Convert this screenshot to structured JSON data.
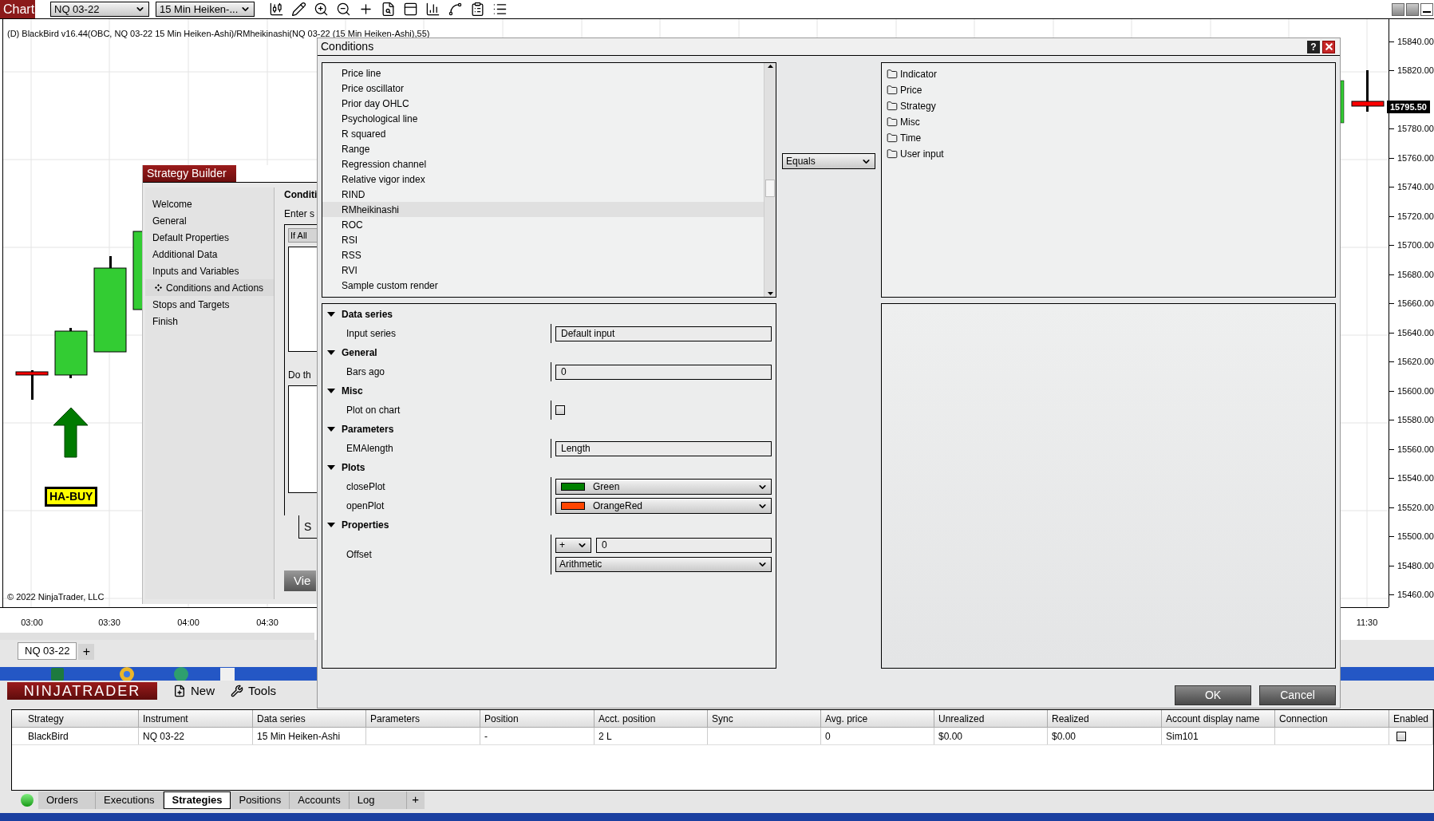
{
  "toolbar": {
    "title": "Chart",
    "instrument": "NQ 03-22",
    "bar_type": "15 Min Heiken-..."
  },
  "chart": {
    "title": "(D) BlackBird v16.44(OBC, NQ 03-22 15 Min Heiken-Ashi)/RMheikinashi(NQ 03-22 (15 Min Heiken-Ashi),55)",
    "signal": "HA-BUY",
    "copyright": "© 2022 NinjaTrader, LLC",
    "price_labels": [
      "15840.00",
      "15820.00",
      "15780.00",
      "15760.00",
      "15740.00",
      "15720.00",
      "15700.00",
      "15680.00",
      "15660.00",
      "15640.00",
      "15620.00",
      "15600.00",
      "15580.00",
      "15560.00",
      "15540.00",
      "15520.00",
      "15500.00",
      "15480.00",
      "15460.00"
    ],
    "last_price": "15795.50",
    "time_labels": [
      "03:00",
      "03:30",
      "04:00",
      "04:30",
      "11:30"
    ]
  },
  "chart_tabs": {
    "tabs": [
      {
        "label": "NQ 03-22",
        "selected": true
      }
    ],
    "add": "+"
  },
  "strategy_builder": {
    "title": "Strategy Builder",
    "nav": [
      {
        "label": "Welcome",
        "selected": false
      },
      {
        "label": "General",
        "selected": false
      },
      {
        "label": "Default Properties",
        "selected": false
      },
      {
        "label": "Additional Data",
        "selected": false
      },
      {
        "label": "Inputs and Variables",
        "selected": false
      },
      {
        "label": "Conditions and Actions",
        "selected": true
      },
      {
        "label": "Stops and Targets",
        "selected": false
      },
      {
        "label": "Finish",
        "selected": false
      }
    ],
    "heading": "Conditi",
    "hint": "Enter s",
    "if_all": "If All",
    "do_label": "Do th",
    "tab": "S",
    "view_button": "Vie"
  },
  "conditions": {
    "title": "Conditions",
    "help": "?",
    "items": [
      {
        "label": "Price line",
        "selected": false
      },
      {
        "label": "Price oscillator",
        "selected": false
      },
      {
        "label": "Prior day OHLC",
        "selected": false
      },
      {
        "label": "Psychological line",
        "selected": false
      },
      {
        "label": "R squared",
        "selected": false
      },
      {
        "label": "Range",
        "selected": false
      },
      {
        "label": "Regression channel",
        "selected": false
      },
      {
        "label": "Relative vigor index",
        "selected": false
      },
      {
        "label": "RIND",
        "selected": false
      },
      {
        "label": "RMheikinashi",
        "selected": true
      },
      {
        "label": "ROC",
        "selected": false
      },
      {
        "label": "RSI",
        "selected": false
      },
      {
        "label": "RSS",
        "selected": false
      },
      {
        "label": "RVI",
        "selected": false
      },
      {
        "label": "Sample custom render",
        "selected": false
      }
    ],
    "operator": "Equals",
    "tree": [
      {
        "label": "Indicator"
      },
      {
        "label": "Price"
      },
      {
        "label": "Strategy"
      },
      {
        "label": "Misc"
      },
      {
        "label": "Time"
      },
      {
        "label": "User input"
      }
    ],
    "properties": [
      {
        "label": "Data series",
        "expanded": true,
        "rows": [
          {
            "label": "Input series",
            "kind": "text",
            "value": "Default input"
          }
        ]
      },
      {
        "label": "General",
        "expanded": true,
        "rows": [
          {
            "label": "Bars ago",
            "kind": "text",
            "value": "0"
          }
        ]
      },
      {
        "label": "Misc",
        "expanded": true,
        "rows": [
          {
            "label": "Plot on chart",
            "kind": "checkbox",
            "checked": false
          }
        ]
      },
      {
        "label": "Parameters",
        "expanded": true,
        "rows": [
          {
            "label": "EMAlength",
            "kind": "text",
            "value": "Length"
          }
        ]
      },
      {
        "label": "Plots",
        "expanded": true,
        "rows": [
          {
            "label": "closePlot",
            "kind": "color",
            "color": "#008000",
            "value": "Green"
          },
          {
            "label": "openPlot",
            "kind": "color",
            "color": "#ff4500",
            "value": "OrangeRed"
          }
        ]
      },
      {
        "label": "Properties",
        "expanded": true,
        "rows": [
          {
            "label": "Offset",
            "kind": "offset",
            "operator": "+",
            "value": "0",
            "mode": "Arithmetic"
          }
        ]
      }
    ],
    "buttons": [
      "OK",
      "Cancel"
    ]
  },
  "control_center": {
    "logo": "NINJATRADER",
    "menu": [
      {
        "label": "New",
        "kind": "new"
      },
      {
        "label": "Tools",
        "kind": "tools"
      }
    ],
    "columns": [
      "Strategy",
      "Instrument",
      "Data series",
      "Parameters",
      "Position",
      "Acct. position",
      "Sync",
      "Avg. price",
      "Unrealized",
      "Realized",
      "Account display name",
      "Connection",
      "Enabled"
    ],
    "rows": [
      {
        "strategy": "BlackBird",
        "instrument": "NQ 03-22",
        "data_series": "15 Min Heiken-Ashi",
        "position": "-",
        "acct_position": "2 L",
        "avg_price": "0",
        "unrealized": "$0.00",
        "realized": "$0.00",
        "account": "Sim101",
        "enabled": false
      }
    ],
    "tabs": [
      {
        "label": "Orders",
        "selected": false
      },
      {
        "label": "Executions",
        "selected": false
      },
      {
        "label": "Strategies",
        "selected": true
      },
      {
        "label": "Positions",
        "selected": false
      },
      {
        "label": "Accounts",
        "selected": false
      },
      {
        "label": "Log",
        "selected": false
      }
    ],
    "add_tab": "+"
  }
}
